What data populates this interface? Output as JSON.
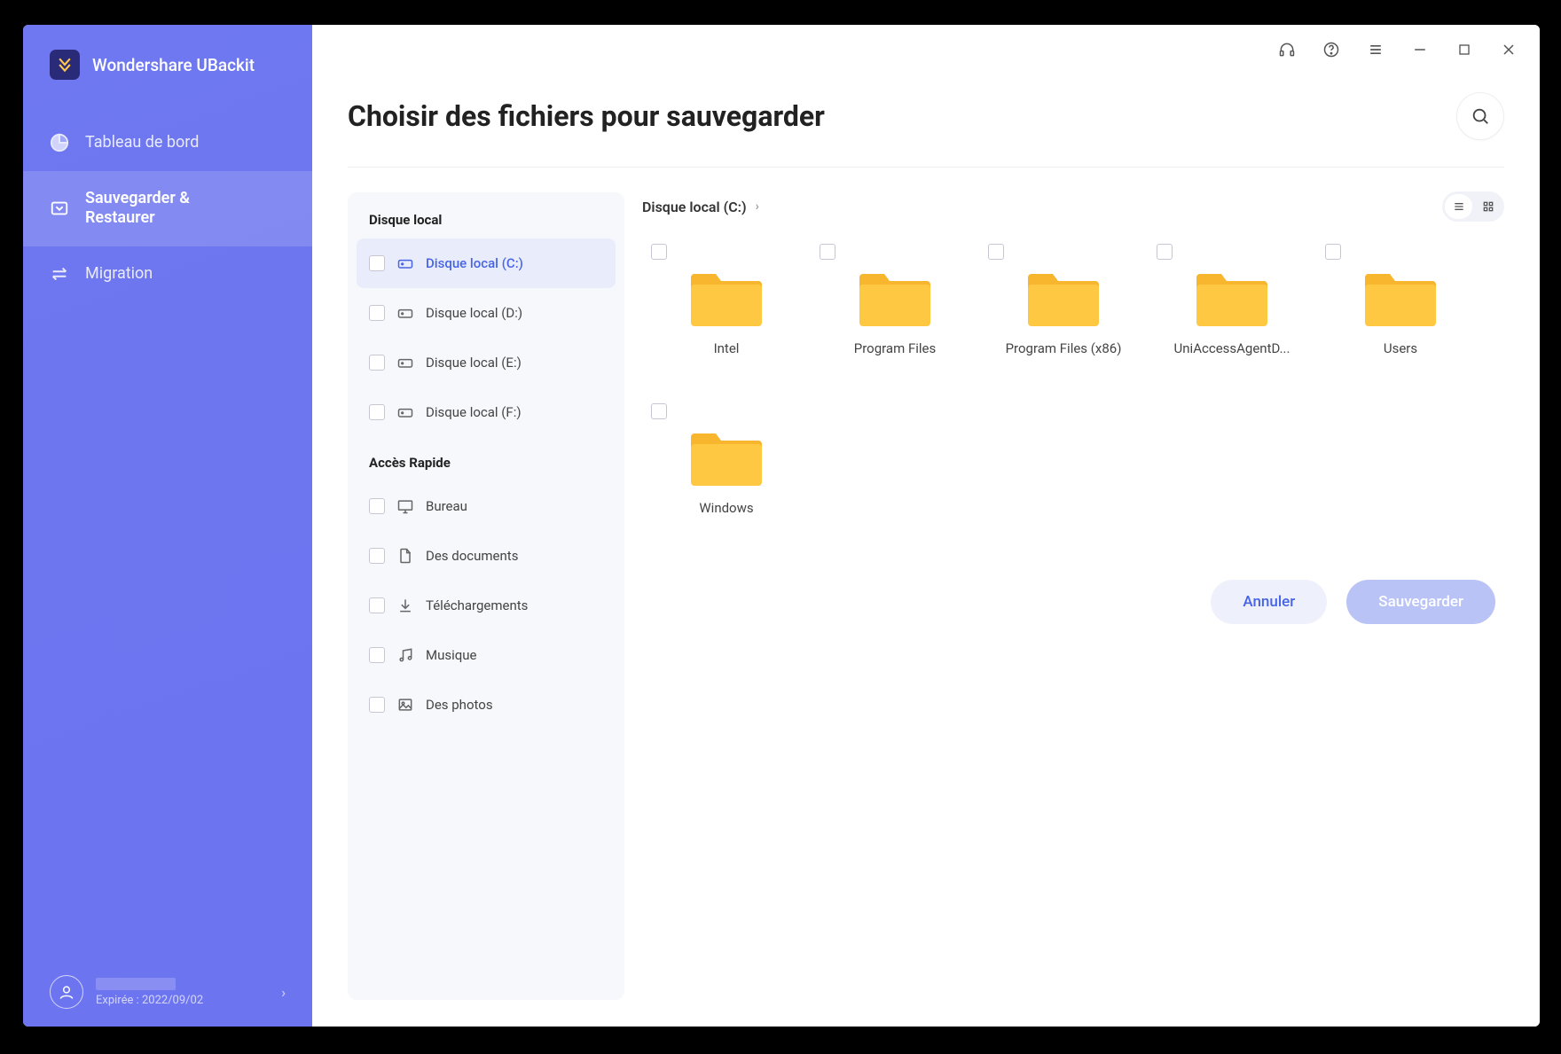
{
  "app": {
    "title": "Wondershare UBackit"
  },
  "sidebar": {
    "items": [
      {
        "label": "Tableau de bord",
        "icon": "pie"
      },
      {
        "label": "Sauvegarder &\nRestaurer",
        "icon": "backup",
        "active": true
      },
      {
        "label": "Migration",
        "icon": "swap"
      }
    ],
    "account": {
      "expiry_label": "Expirée : 2022/09/02"
    }
  },
  "page": {
    "title": "Choisir des fichiers pour sauvegarder",
    "breadcrumb": "Disque local (C:)"
  },
  "panel": {
    "group1_title": "Disque local",
    "group2_title": "Accès Rapide",
    "disks": [
      {
        "label": "Disque local (C:)",
        "active": true
      },
      {
        "label": "Disque local (D:)"
      },
      {
        "label": "Disque local (E:)"
      },
      {
        "label": "Disque local (F:)"
      }
    ],
    "quick": [
      {
        "label": "Bureau",
        "icon": "monitor"
      },
      {
        "label": "Des documents",
        "icon": "doc"
      },
      {
        "label": "Téléchargements",
        "icon": "download"
      },
      {
        "label": "Musique",
        "icon": "music"
      },
      {
        "label": "Des photos",
        "icon": "image"
      }
    ]
  },
  "folders": [
    {
      "label": "Intel"
    },
    {
      "label": "Program Files"
    },
    {
      "label": "Program Files (x86)"
    },
    {
      "label": "UniAccessAgentD..."
    },
    {
      "label": "Users"
    },
    {
      "label": "Windows"
    }
  ],
  "footer": {
    "cancel": "Annuler",
    "save": "Sauvegarder"
  }
}
